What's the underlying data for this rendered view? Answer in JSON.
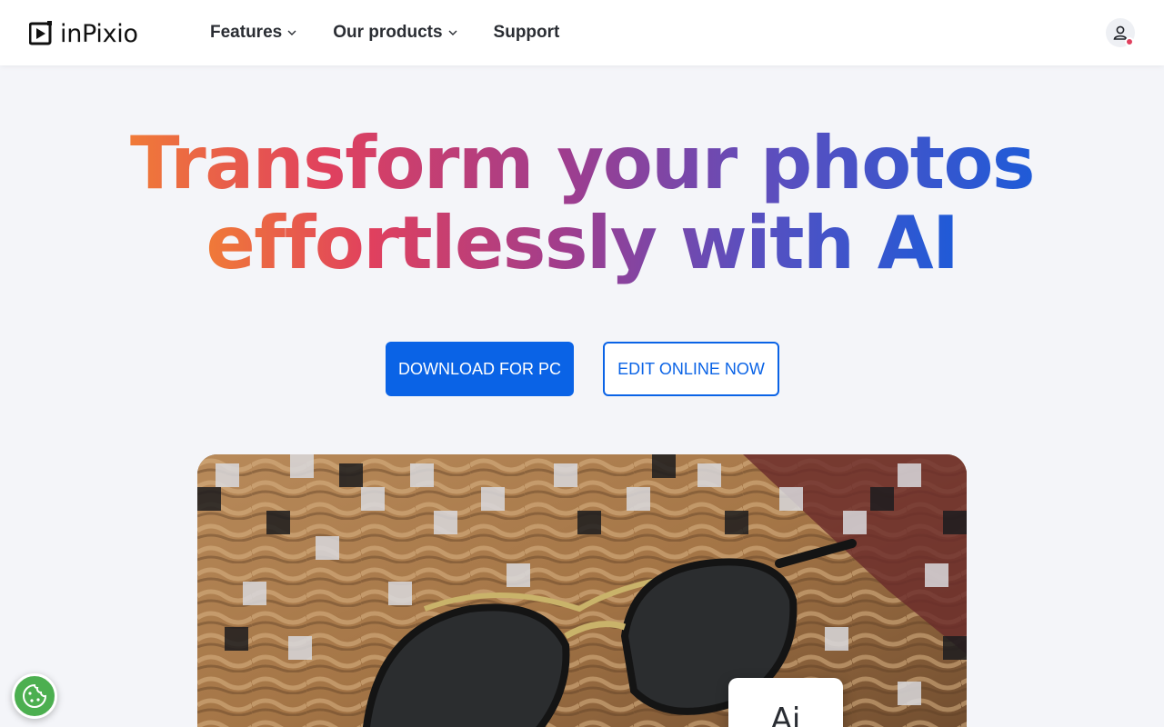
{
  "header": {
    "logo_text": "inPixio",
    "nav": [
      {
        "label": "Features",
        "has_dropdown": true
      },
      {
        "label": "Our products",
        "has_dropdown": true
      },
      {
        "label": "Support",
        "has_dropdown": false
      }
    ],
    "account_icon": "user-icon"
  },
  "hero": {
    "title_line1": "Transform your photos",
    "title_line2": "effortlessly with AI",
    "primary_button": "DOWNLOAD FOR PC",
    "secondary_button": "EDIT ONLINE NOW"
  },
  "showcase": {
    "badge_text": "Ai"
  },
  "cookie": {
    "icon": "cookie-icon"
  },
  "colors": {
    "accent": "#0a63e6",
    "gradient_start": "#f07a38",
    "gradient_mid": "#9f3d8e",
    "gradient_end": "#1f5bd8",
    "cookie_green": "#4caf50",
    "notification_dot": "#e0405e"
  }
}
